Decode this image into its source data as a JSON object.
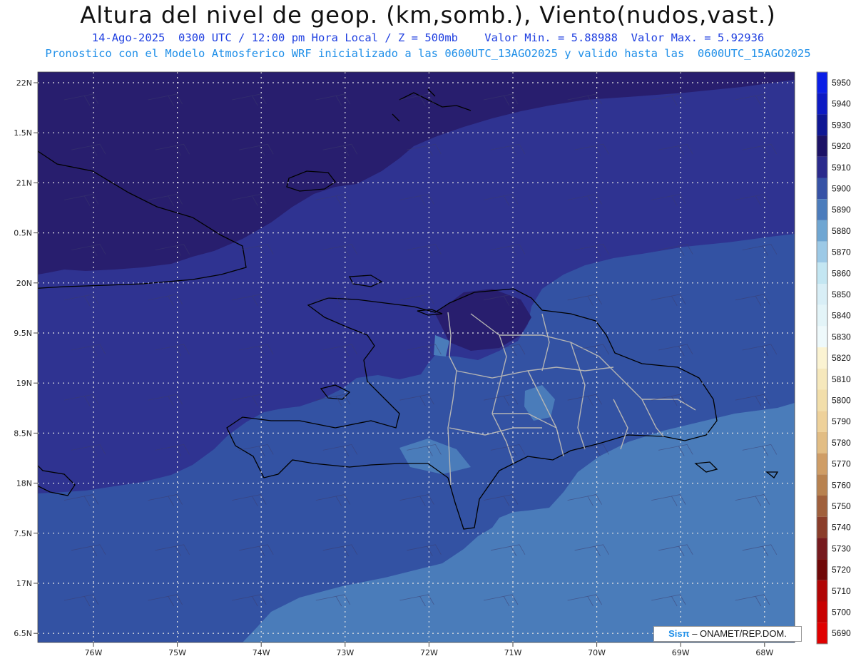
{
  "header": {
    "title": "Altura del nivel de geop. (km,somb.), Viento(nudos,vast.)",
    "line1": "14-Ago-2025  0300 UTC / 12:00 pm Hora Local / Z = 500mb    Valor Min. = 5.88988  Valor Max. = 5.92936",
    "line2": "Pronostico con el Modelo Atmosferico WRF inicializado a las 0600UTC_13AGO2025 y valido hasta las  0600UTC_15AGO2025"
  },
  "map": {
    "lat_labels": [
      "22N",
      "1.5N",
      "21N",
      "0.5N",
      "20N",
      "9.5N",
      "19N",
      "8.5N",
      "18N",
      "7.5N",
      "17N",
      "6.5N"
    ],
    "lon_labels": [
      "76W",
      "75W",
      "74W",
      "73W",
      "72W",
      "71W",
      "70W",
      "69W",
      "68W"
    ],
    "fill_colors": {
      "level_5920": "#281e6e",
      "level_5910": "#2f3391",
      "level_5900": "#3352a3",
      "level_5890": "#4a7cba"
    },
    "land_boundary_color": "#000000",
    "province_boundary_color": "#b4b4b4",
    "grid_color": "#e6e6e6"
  },
  "colorbar": {
    "levels": [
      "5950",
      "5940",
      "5930",
      "5920",
      "5910",
      "5900",
      "5890",
      "5880",
      "5870",
      "5860",
      "5850",
      "5840",
      "5830",
      "5820",
      "5810",
      "5800",
      "5790",
      "5780",
      "5770",
      "5760",
      "5750",
      "5740",
      "5730",
      "5720",
      "5710",
      "5700",
      "5690"
    ],
    "colors": [
      "#0a1ee6",
      "#0d1ac3",
      "#0f1794",
      "#1c1266",
      "#2a2a8c",
      "#3652a6",
      "#4b7cbc",
      "#6fa6d2",
      "#9cc9e6",
      "#c3e6f2",
      "#d8eef6",
      "#e3f4f8",
      "#eef9fb",
      "#fbf3d2",
      "#f6e8bc",
      "#f2deaa",
      "#eed19a",
      "#e2bd84",
      "#cf9d66",
      "#b88250",
      "#a0603c",
      "#8a3d2a",
      "#761a1e",
      "#700808",
      "#b00505",
      "#c80000",
      "#e00000"
    ]
  },
  "credit": {
    "brand": "Sisπ",
    "org": "– ONAMET/REP.DOM."
  }
}
